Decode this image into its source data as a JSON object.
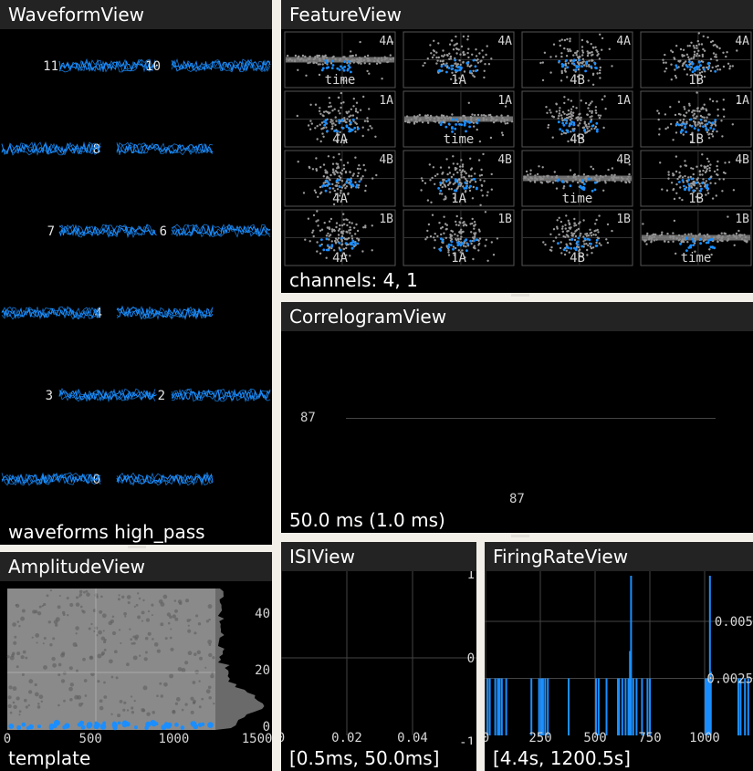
{
  "waveform": {
    "title": "WaveformView",
    "status": "waveforms high_pass",
    "color": "#1b8eff",
    "channels": [
      "11",
      "10",
      "8",
      "7",
      "6",
      "4",
      "3",
      "2",
      "0"
    ]
  },
  "feature": {
    "title": "FeatureView",
    "status": "channels: 4, 1",
    "rows": [
      {
        "corner": "4A",
        "bottom": [
          "time",
          "1A",
          "4B",
          "1B"
        ]
      },
      {
        "corner": "1A",
        "bottom": [
          "4A",
          "time",
          "4B",
          "1B"
        ]
      },
      {
        "corner": "4B",
        "bottom": [
          "4A",
          "1A",
          "time",
          "1B"
        ]
      },
      {
        "corner": "1B",
        "bottom": [
          "4A",
          "1A",
          "4B",
          "time"
        ]
      }
    ]
  },
  "correlogram": {
    "title": "CorrelogramView",
    "status": "50.0 ms (1.0 ms)",
    "left_label": "87",
    "bottom_label": "87"
  },
  "amplitude": {
    "title": "AmplitudeView",
    "status": "template",
    "x_ticks": [
      "0",
      "500",
      "1000",
      "1500"
    ],
    "y_ticks": [
      "40",
      "20",
      "0"
    ]
  },
  "isi": {
    "title": "ISIView",
    "status": "[0.5ms, 50.0ms]",
    "x_ticks": [
      "0",
      "0.02",
      "0.04"
    ],
    "y_ticks": [
      "1",
      "0",
      "-1"
    ]
  },
  "firing_rate": {
    "title": "FiringRateView",
    "status": "[4.4s, 1200.5s]",
    "x_ticks": [
      "0",
      "250",
      "500",
      "750",
      "1000"
    ],
    "y_ticks": [
      "0.005",
      "0.0025"
    ]
  }
}
